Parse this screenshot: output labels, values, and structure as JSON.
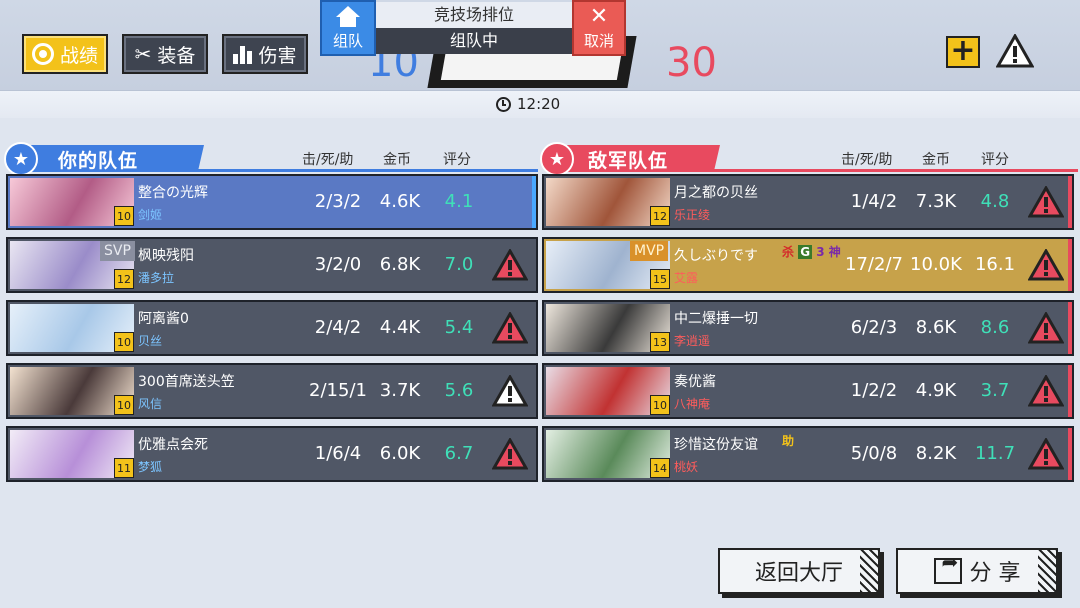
{
  "header": {
    "tabs": [
      {
        "label": "战绩",
        "icon": "record-icon",
        "active": true
      },
      {
        "label": "装备",
        "icon": "equipment-icon",
        "active": false
      },
      {
        "label": "伤害",
        "icon": "damage-chart-icon",
        "active": false
      }
    ],
    "score_ally": "10",
    "score_enemy": "30",
    "timer": "12:20"
  },
  "queue": {
    "title": "竞技场排位",
    "status": "组队中",
    "team_button": "组队",
    "cancel_button": "取消"
  },
  "columns": {
    "kda": "击/死/助",
    "gold": "金币",
    "rating": "评分"
  },
  "ally_team": {
    "name": "你的队伍",
    "players": [
      {
        "name": "整合の光辉",
        "hero": "剑姬",
        "level": "10",
        "kda": "2/3/2",
        "gold": "4.6K",
        "rating": "4.1",
        "tag": ""
      },
      {
        "name": "枫映残阳",
        "hero": "潘多拉",
        "level": "12",
        "kda": "3/2/0",
        "gold": "6.8K",
        "rating": "7.0",
        "tag": "SVP"
      },
      {
        "name": "阿离酱0",
        "hero": "贝丝",
        "level": "10",
        "kda": "2/4/2",
        "gold": "4.4K",
        "rating": "5.4",
        "tag": ""
      },
      {
        "name": "300首席送头笠",
        "hero": "风信",
        "level": "10",
        "kda": "2/15/1",
        "gold": "3.7K",
        "rating": "5.6",
        "tag": ""
      },
      {
        "name": "优雅点会死",
        "hero": "梦狐",
        "level": "11",
        "kda": "1/6/4",
        "gold": "6.0K",
        "rating": "6.7",
        "tag": ""
      }
    ]
  },
  "enemy_team": {
    "name": "敌军队伍",
    "players": [
      {
        "name": "月之都の贝丝",
        "hero": "乐正绫",
        "level": "12",
        "kda": "1/4/2",
        "gold": "7.3K",
        "rating": "4.8",
        "tag": ""
      },
      {
        "name": "久しぶりです",
        "hero": "艾露",
        "level": "15",
        "kda": "17/2/7",
        "gold": "10.0K",
        "rating": "16.1",
        "tag": "MVP"
      },
      {
        "name": "中二爆捶一切",
        "hero": "李逍遥",
        "level": "13",
        "kda": "6/2/3",
        "gold": "8.6K",
        "rating": "8.6",
        "tag": ""
      },
      {
        "name": "奏优酱",
        "hero": "八神庵",
        "level": "10",
        "kda": "1/2/2",
        "gold": "4.9K",
        "rating": "3.7",
        "tag": ""
      },
      {
        "name": "珍惜这份友谊",
        "hero": "桃妖",
        "level": "14",
        "kda": "5/0/8",
        "gold": "8.2K",
        "rating": "11.7",
        "tag": ""
      }
    ],
    "mvp_badges": [
      "杀",
      "G",
      "3",
      "神"
    ],
    "assist_badge": "助"
  },
  "footer": {
    "back_button": "返回大厅",
    "share_button": "分 享"
  },
  "colors": {
    "ally": "#3f7de0",
    "enemy": "#e84a5f",
    "accent": "#f3c21a",
    "rating": "#3fe0b8"
  }
}
